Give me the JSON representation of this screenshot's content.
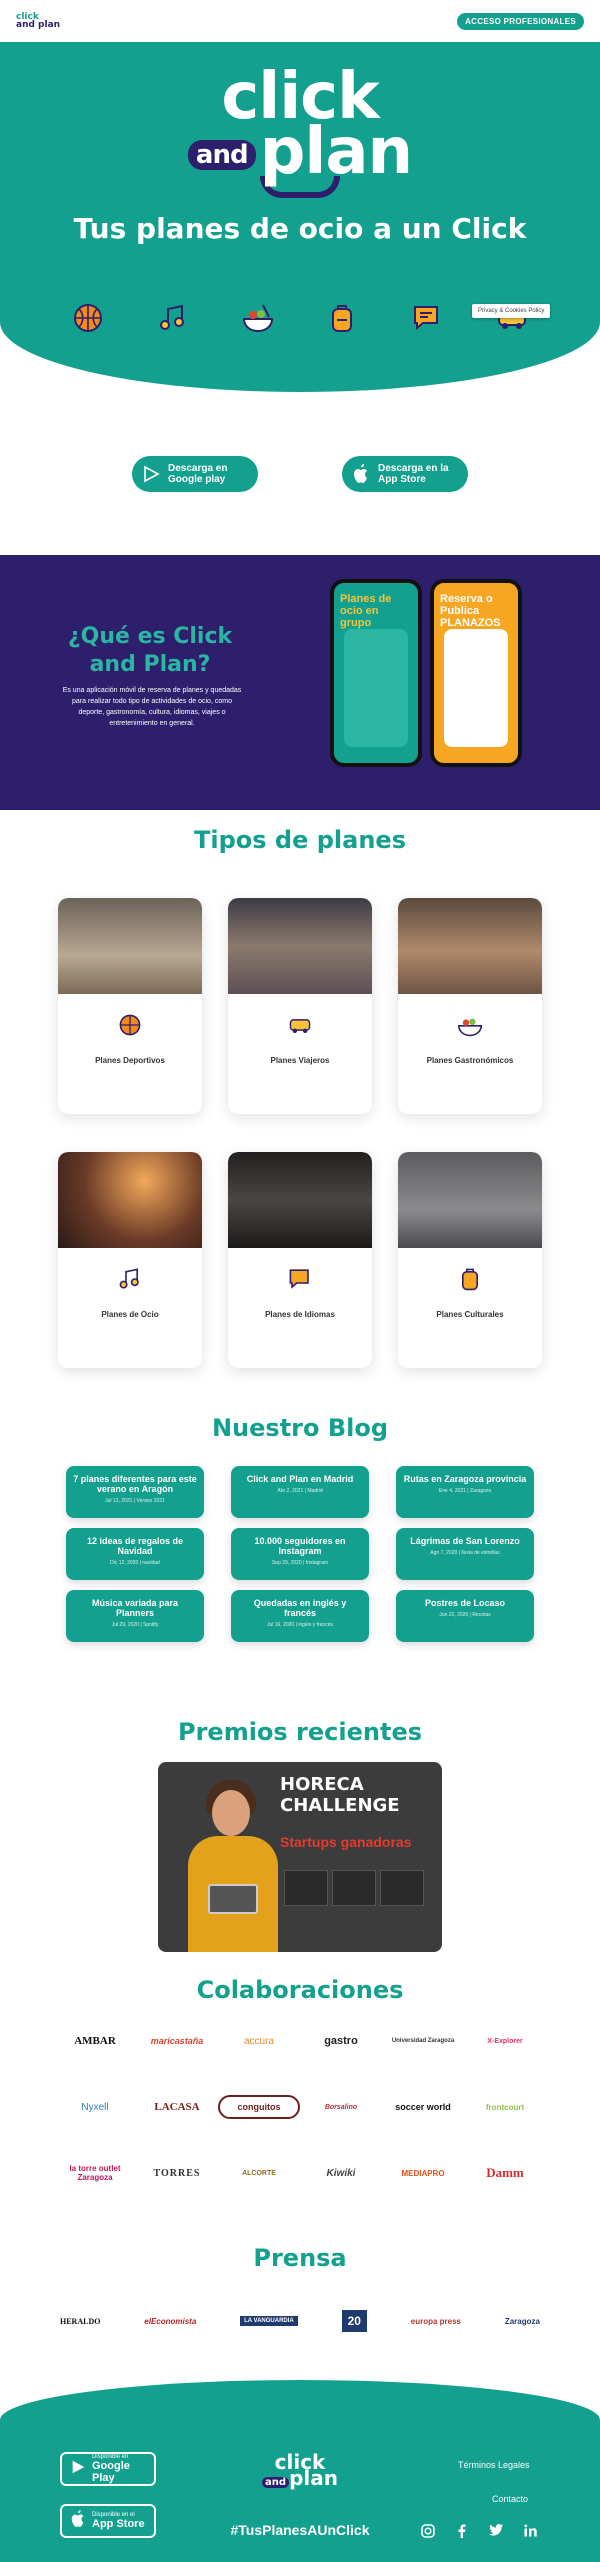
{
  "header": {
    "logo_top": "click",
    "logo_bottom": "and plan",
    "pro_button": "ACCESO PROFESIONALES"
  },
  "hero": {
    "logo_line1": "click",
    "logo_and": "and",
    "logo_line2": "plan",
    "title": "Tus planes de ocio a un Click",
    "icons": [
      "basketball-icon",
      "music-note-icon",
      "food-bowl-icon",
      "backpack-icon",
      "chat-bubble-icon",
      "bus-icon"
    ],
    "cookie_label": "Privacy & Cookies Policy"
  },
  "stores": {
    "google": "Descarga en Google play",
    "apple": "Descarga en la App Store"
  },
  "what": {
    "title": "¿Qué es Click and Plan?",
    "description": "Es una aplicación móvil de reserva de planes y quedadas para realizar todo tipo de actividades de ocio, como deporte, gastronomía, cultura, idiomas, viajes o entretenimiento en general.",
    "phone1": "Planes de ocio en grupo",
    "phone2": "Reserva o Publica PLANAZOS"
  },
  "tipos": {
    "title": "Tipos de planes",
    "items": [
      {
        "label": "Planes Deportivos",
        "icon": "basketball-icon"
      },
      {
        "label": "Planes Viajeros",
        "icon": "bus-icon"
      },
      {
        "label": "Planes Gastronómicos",
        "icon": "food-bowl-icon"
      },
      {
        "label": "Planes de Ocio",
        "icon": "music-note-icon"
      },
      {
        "label": "Planes de Idiomas",
        "icon": "chat-bubble-icon"
      },
      {
        "label": "Planes Culturales",
        "icon": "backpack-icon"
      }
    ]
  },
  "blog": {
    "title": "Nuestro Blog",
    "posts": [
      {
        "title": "7 planes diferentes para este verano en Aragón",
        "meta": "Jul 13, 2021 | Verano 2021"
      },
      {
        "title": "Click and Plan en Madrid",
        "meta": "Abr 2, 2021 | Madrid"
      },
      {
        "title": "Rutas en Zaragoza provincia",
        "meta": "Ene 4, 2021 | Zaragoza"
      },
      {
        "title": "12 ideas de regalos de Navidad",
        "meta": "Dic 12, 2020 | navidad"
      },
      {
        "title": "10.000 seguidores en Instagram",
        "meta": "Sep 29, 2020 | Instagram"
      },
      {
        "title": "Lágrimas de San Lorenzo",
        "meta": "Ago 7, 2020 | lluvia de estrellas"
      },
      {
        "title": "Música variada para Planners",
        "meta": "Jul 29, 2020 | Spotify"
      },
      {
        "title": "Quedadas en inglés y francés",
        "meta": "Jul 16, 2020 | inglés y francés"
      },
      {
        "title": "Postres de Locaso",
        "meta": "Jun 22, 2020 | Recetas"
      }
    ]
  },
  "premios": {
    "title": "Premios recientes",
    "heading": "HORECA CHALLENGE",
    "subheading": "Startups ganadoras"
  },
  "colaboraciones": {
    "title": "Colaboraciones",
    "logos": [
      "AMBAR",
      "maricastaña",
      "accura",
      "gastro",
      "Universidad Zaragoza",
      "X-Explorer",
      "Nyxell",
      "LACASA",
      "conguitos",
      "Borsalino",
      "soccer world",
      "frontcourt",
      "la torre outlet Zaragoza",
      "TORRES",
      "ALCORTE",
      "Kiwiki",
      "MEDIAPRO",
      "Damm"
    ]
  },
  "prensa": {
    "title": "Prensa",
    "logos": [
      "HERALDO",
      "elEconomista",
      "LA VANGUARDIA",
      "20",
      "europa press",
      "Zaragoza"
    ]
  },
  "footer": {
    "google_small": "Disponible en",
    "google_big": "Google Play",
    "apple_small": "Disponible en el",
    "apple_big": "App Store",
    "logo_top": "click",
    "logo_and": "and",
    "logo_bottom": "plan",
    "hashtag": "#TusPlanesAUnClick",
    "terms": "Términos Legales",
    "contact": "Contacto",
    "social": [
      "instagram-icon",
      "facebook-icon",
      "twitter-icon",
      "linkedin-icon"
    ]
  }
}
